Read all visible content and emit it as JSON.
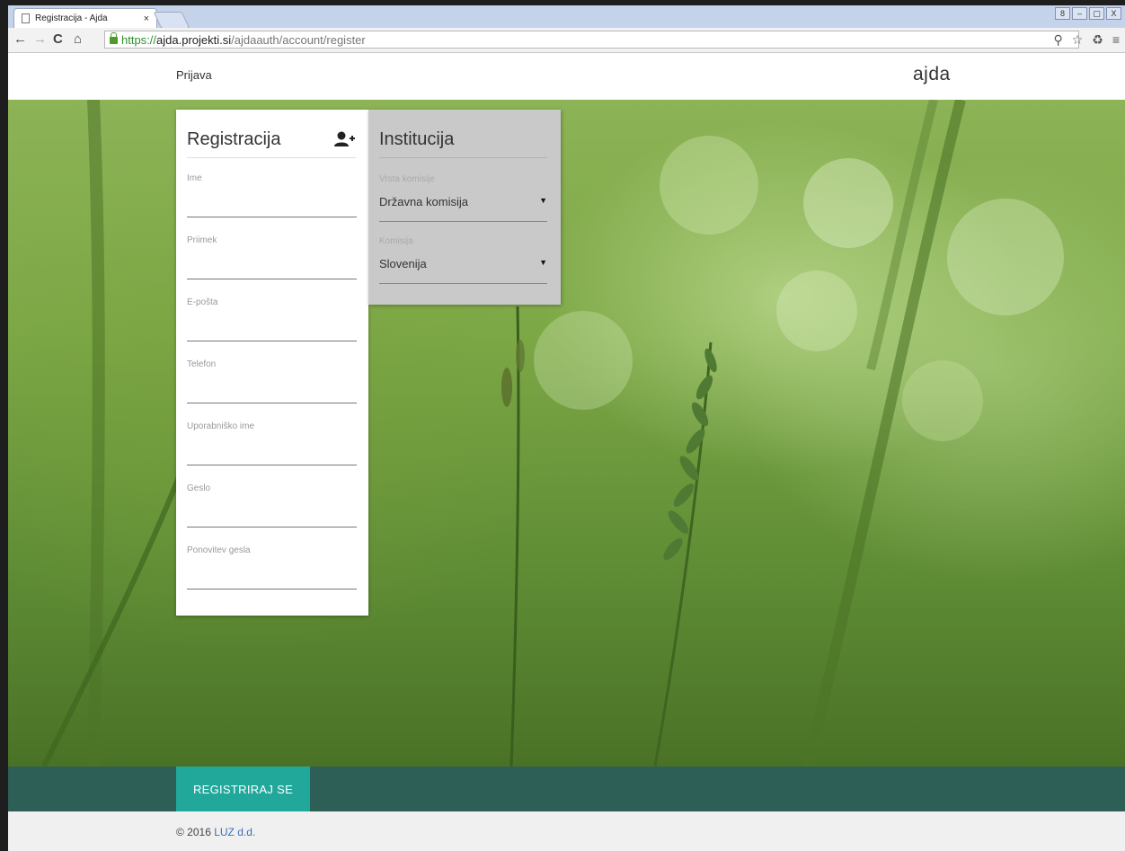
{
  "browser": {
    "tab_title": "Registracija - Ajda",
    "tab_close": "×",
    "url_scheme": "https://",
    "url_host": "ajda.projekti.si",
    "url_path": "/ajdaauth/account/register",
    "window_buttons": [
      "8",
      "–",
      "▢",
      "X"
    ]
  },
  "header": {
    "login_link": "Prijava",
    "brand": "ajda"
  },
  "register_form": {
    "title": "Registracija",
    "fields": [
      {
        "label": "Ime",
        "value": ""
      },
      {
        "label": "Priimek",
        "value": ""
      },
      {
        "label": "E-pošta",
        "value": ""
      },
      {
        "label": "Telefon",
        "value": ""
      },
      {
        "label": "Uporabniško ime",
        "value": ""
      },
      {
        "label": "Geslo",
        "value": ""
      },
      {
        "label": "Ponovitev gesla",
        "value": ""
      }
    ]
  },
  "institution": {
    "title": "Institucija",
    "commission_type": {
      "label": "Vrsta komisije",
      "value": "Državna komisija"
    },
    "commission": {
      "label": "Komisija",
      "value": "Slovenija"
    }
  },
  "actions": {
    "register_label": "REGISTRIRAJ SE"
  },
  "footer": {
    "copyright": "© 2016",
    "company": "LUZ d.d."
  },
  "colors": {
    "accent": "#22a89a",
    "action_bar": "#2e5f56",
    "institution_panel": "#c9c9c9"
  }
}
